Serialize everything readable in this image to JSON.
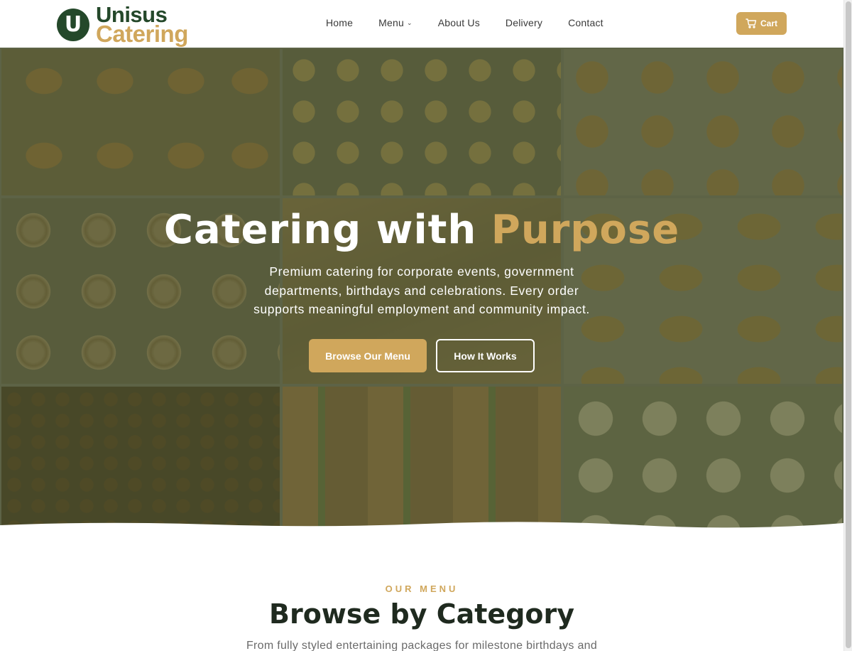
{
  "brand": {
    "logo_mark": "U",
    "name_top": "Unisus",
    "name_bottom": "Catering"
  },
  "nav": {
    "items": [
      {
        "label": "Home"
      },
      {
        "label": "Menu",
        "has_dropdown": true
      },
      {
        "label": "About Us"
      },
      {
        "label": "Delivery"
      },
      {
        "label": "Contact"
      }
    ],
    "cart_label": "Cart",
    "cart_icon": "cart-icon"
  },
  "hero": {
    "title_main": "Catering with ",
    "title_accent": "Purpose",
    "subtitle": "Premium catering for corporate events, government departments, birthdays and celebrations. Every order supports meaningful employment and community impact.",
    "primary_button": "Browse Our Menu",
    "secondary_button": "How It Works"
  },
  "menu_section": {
    "eyebrow": "OUR MENU",
    "title": "Browse by Category",
    "description": "From fully styled entertaining packages for milestone birthdays and"
  },
  "colors": {
    "brand_green": "#24482a",
    "brand_gold": "#d0a75c",
    "text_dark": "#1f2a1f"
  }
}
